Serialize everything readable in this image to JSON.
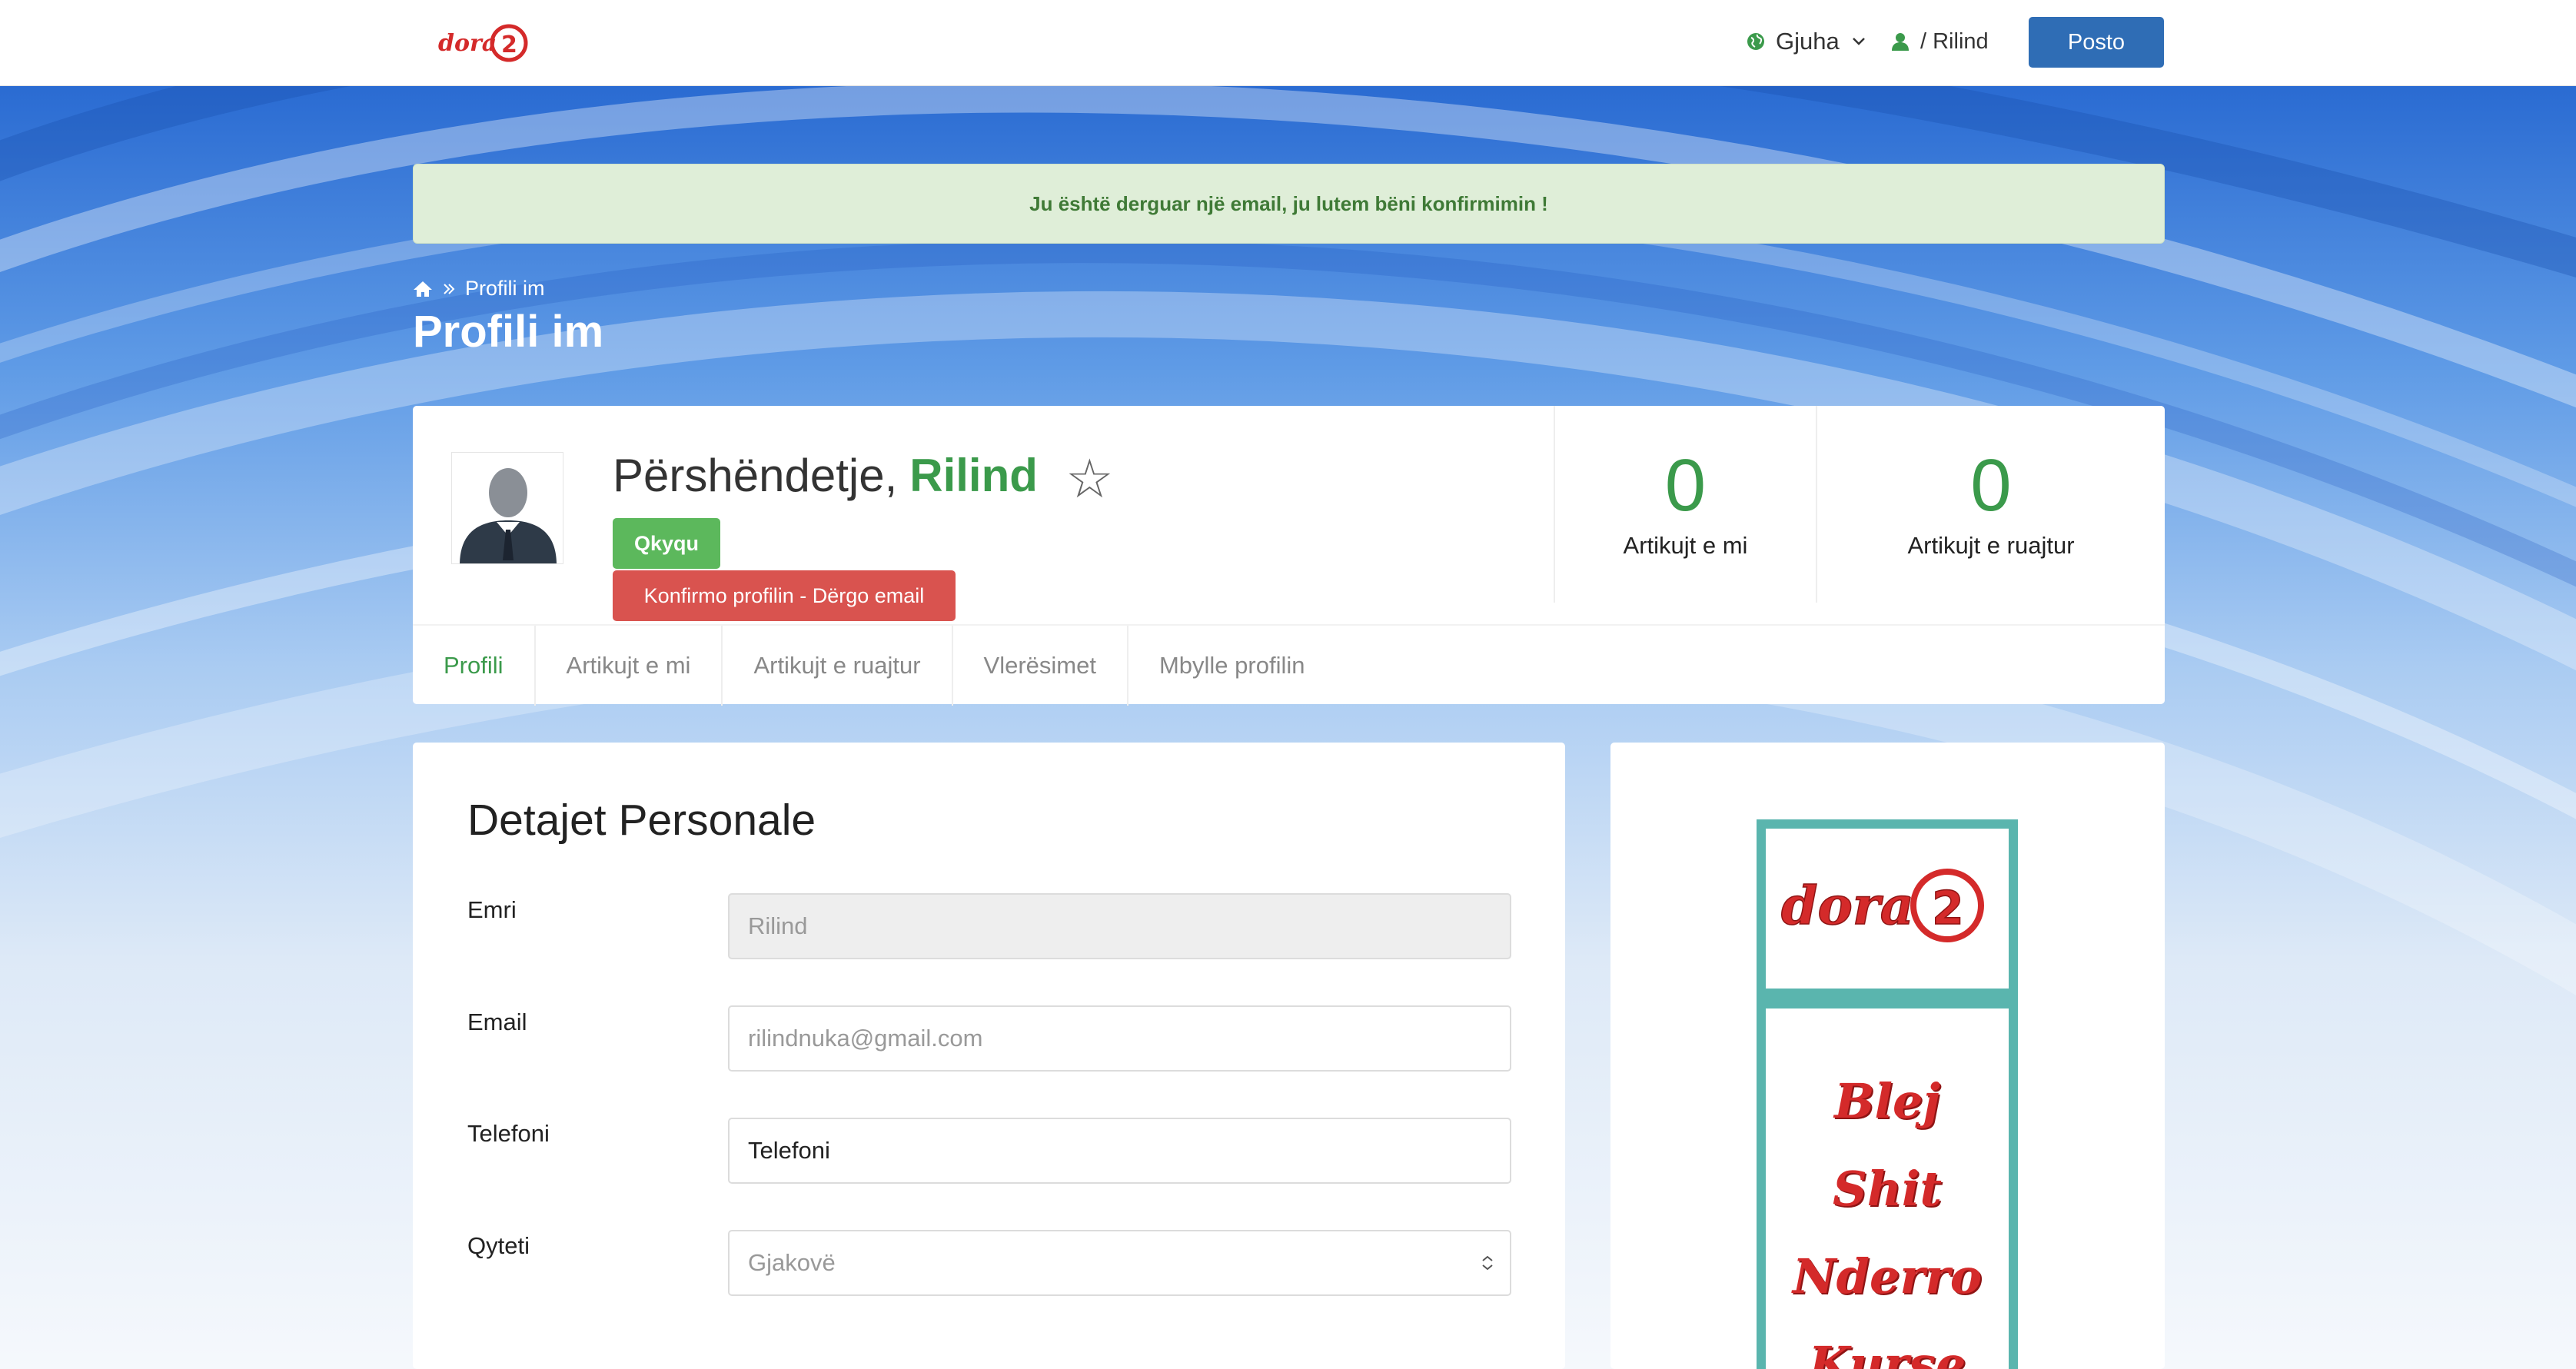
{
  "header": {
    "logo_text": "dora2",
    "language_label": "Gjuha",
    "user_label": "/ Rilind",
    "post_button": "Posto"
  },
  "alert": {
    "message": "Ju është derguar një email, ju lutem bëni konfirmimin !"
  },
  "breadcrumb": {
    "current": "Profili im"
  },
  "page": {
    "title": "Profili im"
  },
  "profile": {
    "greeting": "Përshëndetje,",
    "name": "Rilind",
    "logout_button": "Qkyqu",
    "confirm_button": "Konfirmo profilin - Dërgo email",
    "stats": [
      {
        "value": "0",
        "label": "Artikujt e mi"
      },
      {
        "value": "0",
        "label": "Artikujt e ruajtur"
      }
    ],
    "tabs": [
      "Profili",
      "Artikujt e mi",
      "Artikujt e ruajtur",
      "Vlerësimet",
      "Mbylle profilin"
    ]
  },
  "details": {
    "title": "Detajet Personale",
    "fields": [
      {
        "label": "Emri",
        "value": "Rilind"
      },
      {
        "label": "Email",
        "value": "rilindnuka@gmail.com"
      },
      {
        "label": "Telefoni",
        "value": "Telefoni"
      },
      {
        "label": "Qyteti",
        "value": "Gjakovë"
      }
    ]
  },
  "ad": {
    "logo_text": "dora2",
    "words": [
      "Blej",
      "Shit",
      "Nderro",
      "Kurse"
    ]
  },
  "colors": {
    "accent_green": "#3b9a4b",
    "primary_blue": "#2f6db5",
    "danger_red": "#d9534f",
    "success_green": "#5cb85c",
    "ad_teal": "#5ab5ae"
  }
}
